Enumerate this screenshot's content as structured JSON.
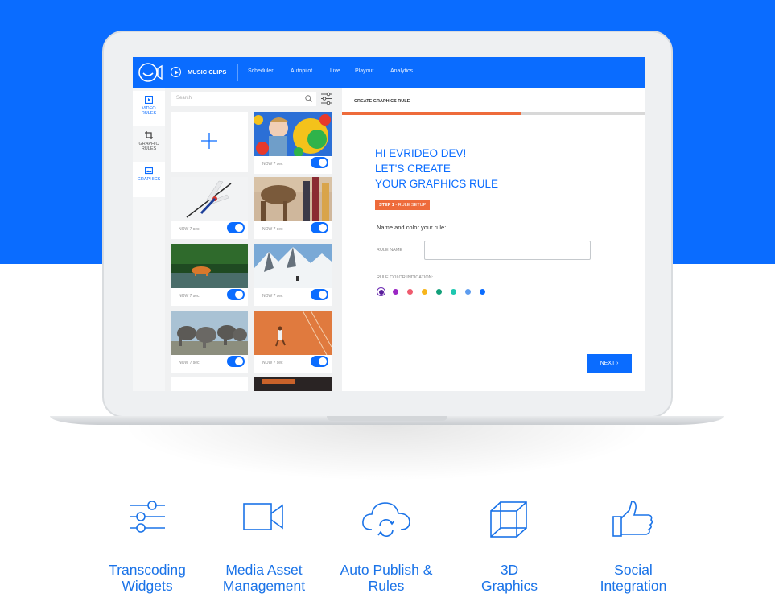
{
  "app": {
    "brand": "MUSIC CLIPS",
    "nav": [
      "Scheduler",
      "Autopilot",
      "Live",
      "Playout",
      "Analytics"
    ]
  },
  "sidebar": {
    "items": [
      {
        "label": "VIDEO\nRULES",
        "icon": "video-rules-icon"
      },
      {
        "label": "GRAPHIC\nRULES",
        "icon": "crop-icon"
      },
      {
        "label": "GRAPHICS",
        "icon": "image-icon"
      }
    ]
  },
  "gallery": {
    "search_placeholder": "Search",
    "cards": [
      {
        "meta": "NOW 7 sec",
        "thumb": "child-ballpit"
      },
      {
        "meta": "NOW 7 sec",
        "thumb": "dragonfly"
      },
      {
        "meta": "NOW 7 sec",
        "thumb": "camels"
      },
      {
        "meta": "NOW 7 sec",
        "thumb": "tiger-river"
      },
      {
        "meta": "NOW 7 sec",
        "thumb": "snow-mountains"
      },
      {
        "meta": "NOW 7 sec",
        "thumb": "elephants"
      },
      {
        "meta": "NOW 7 sec",
        "thumb": "tennis-court"
      }
    ]
  },
  "main": {
    "breadcrumb": "CREATE GRAPHICS RULE",
    "progress": 0.59,
    "heading_line1": "HI EVRIDEO DEV!",
    "heading_line2": "LET'S CREATE",
    "heading_line3": "YOUR GRAPHICS RULE",
    "step_number": "STEP 1",
    "step_text": " - RULE SETUP",
    "instruction": "Name and color your rule:",
    "rule_name_label": "RULE NAME",
    "rule_name_value": "",
    "color_label": "RULE COLOR INDICATION:",
    "colors": [
      "#5a1f9c",
      "#9b27c4",
      "#ef5b6e",
      "#f7b51b",
      "#13a07a",
      "#1ec7b0",
      "#5d9cef",
      "#0a6cff"
    ],
    "selected_color": "#5a1f9c",
    "next_label": "NEXT"
  },
  "features": [
    {
      "label": "Transcoding\nWidgets",
      "icon": "sliders-icon"
    },
    {
      "label": "Media Asset\nManagement",
      "icon": "video-camera-icon"
    },
    {
      "label": "Auto Publish &\nRules",
      "icon": "cloud-sync-icon"
    },
    {
      "label": "3D\nGraphics",
      "icon": "cube-icon"
    },
    {
      "label": "Social\nIntegration",
      "icon": "thumbs-up-icon"
    }
  ]
}
